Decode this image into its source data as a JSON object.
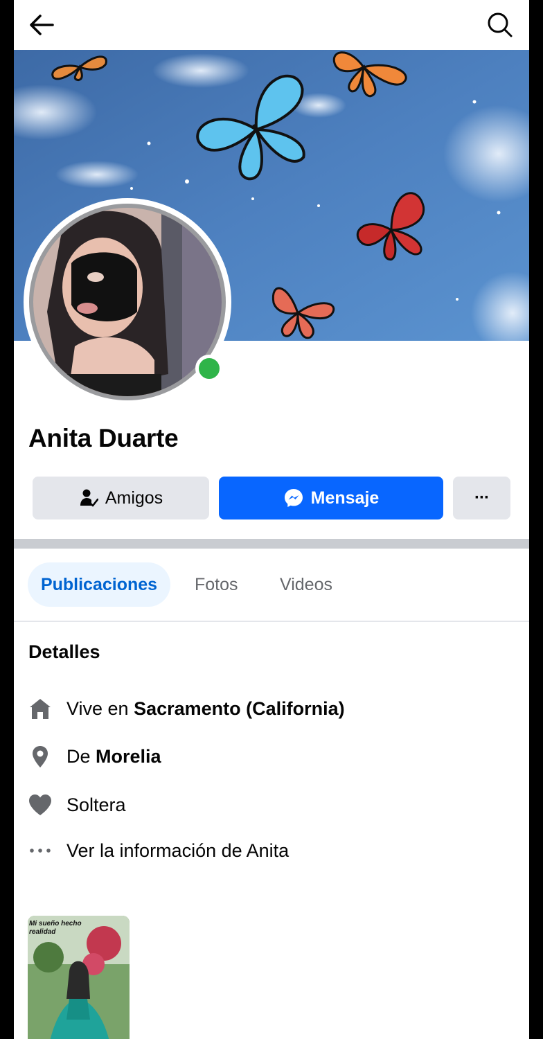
{
  "profile": {
    "name": "Anita Duarte"
  },
  "actions": {
    "friends_label": "Amigos",
    "message_label": "Mensaje",
    "more_label": "···"
  },
  "tabs": [
    {
      "label": "Publicaciones",
      "active": true
    },
    {
      "label": "Fotos",
      "active": false
    },
    {
      "label": "Videos",
      "active": false
    }
  ],
  "details": {
    "title": "Detalles",
    "lives_prefix": "Vive en ",
    "lives_value": "Sacramento (California)",
    "from_prefix": "De ",
    "from_value": "Morelia",
    "relationship": "Soltera",
    "more_info": "Ver la información de Anita"
  },
  "post": {
    "caption": "Mi sueño hecho realidad"
  },
  "icons": {
    "back": "arrow-left-icon",
    "search": "search-icon",
    "friends": "person-check-icon",
    "message": "messenger-icon",
    "more": "ellipsis-icon",
    "home": "home-icon",
    "location": "location-pin-icon",
    "heart": "heart-icon",
    "dots": "dots-icon"
  },
  "colors": {
    "primary": "#0866ff",
    "tab_active_bg": "#ebf5ff",
    "tab_active_text": "#0064d1",
    "online": "#2fb449",
    "button_gray": "#e4e6eb",
    "icon_gray": "#65676b"
  }
}
